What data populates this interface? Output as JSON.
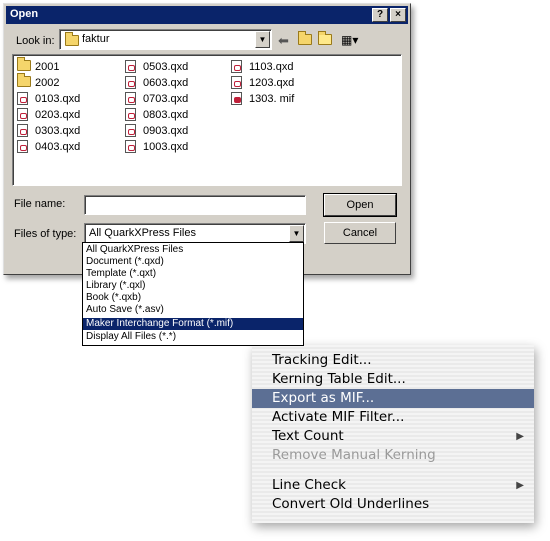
{
  "dialog": {
    "title": "Open",
    "help_label": "?",
    "close_label": "×",
    "look_in_label": "Look in:",
    "look_in_value": "faktur",
    "file_name_label": "File name:",
    "file_name_value": "",
    "files_of_type_label": "Files of type:",
    "files_of_type_value": "All QuarkXPress Files",
    "open_button": "Open",
    "cancel_button": "Cancel",
    "files": [
      {
        "name": "2001",
        "icon": "folder-icon"
      },
      {
        "name": "2002",
        "icon": "folder-icon"
      },
      {
        "name": "0103.qxd",
        "icon": "qxd-file-icon"
      },
      {
        "name": "0203.qxd",
        "icon": "qxd-file-icon"
      },
      {
        "name": "0303.qxd",
        "icon": "qxd-file-icon"
      },
      {
        "name": "0403.qxd",
        "icon": "qxd-file-icon"
      },
      {
        "name": "0503.qxd",
        "icon": "qxd-file-icon"
      },
      {
        "name": "0603.qxd",
        "icon": "qxd-file-icon"
      },
      {
        "name": "0703.qxd",
        "icon": "qxd-file-icon"
      },
      {
        "name": "0803.qxd",
        "icon": "qxd-file-icon"
      },
      {
        "name": "0903.qxd",
        "icon": "qxd-file-icon"
      },
      {
        "name": "1003.qxd",
        "icon": "qxd-file-icon"
      },
      {
        "name": "1103.qxd",
        "icon": "qxd-file-icon"
      },
      {
        "name": "1203.qxd",
        "icon": "qxd-file-icon"
      },
      {
        "name": "1303. mif",
        "icon": "mif-file-icon"
      }
    ],
    "type_options": [
      "All QuarkXPress Files",
      "Document (*.qxd)",
      "Template (*.qxt)",
      "Library (*.qxl)",
      "Book (*.qxb)",
      "Auto Save (*.asv)",
      "Maker Interchange Format (*.mif)",
      "Display All Files (*.*)"
    ],
    "selected_type_option": "Maker Interchange Format (*.mif)"
  },
  "menu": {
    "items": [
      {
        "label": "Tracking Edit...",
        "state": "normal"
      },
      {
        "label": "Kerning Table Edit...",
        "state": "normal"
      },
      {
        "label": "Export as MIF...",
        "state": "highlighted"
      },
      {
        "label": "Activate MIF Filter...",
        "state": "normal"
      },
      {
        "label": "Text Count",
        "state": "normal",
        "submenu": true
      },
      {
        "label": "Remove Manual Kerning",
        "state": "disabled"
      },
      {
        "label": "Line Check",
        "state": "normal",
        "submenu": true
      },
      {
        "label": "Convert Old Underlines",
        "state": "normal"
      }
    ],
    "submenu_glyph": "▶"
  },
  "colors": {
    "titlebar": "#0a246a",
    "dialog_face": "#d4d0c8",
    "list_selection": "#0a246a",
    "menu_highlight": "#5c6f94",
    "menu_disabled_text": "#9a9a9a"
  }
}
